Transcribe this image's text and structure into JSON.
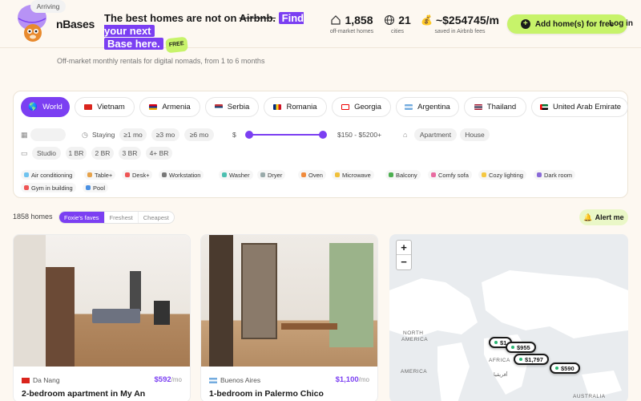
{
  "header": {
    "brand": "nBases",
    "promo": {
      "part1": "The best homes are not on ",
      "strike": "Airbnb.",
      "hl1": "Find your next",
      "hl2": "Base here.",
      "free": "FREE"
    },
    "stats": [
      {
        "icon": "house-icon",
        "value": "1,858",
        "label": "off-market homes"
      },
      {
        "icon": "globe-icon",
        "value": "21",
        "label": "cities"
      },
      {
        "icon": "money-bag-icon",
        "value": "~$254745/m",
        "label": "saved in Airbnb fees"
      }
    ],
    "add_button": "Add home(s) for free",
    "login": "Log in"
  },
  "tagline": "Off-market monthly rentals for digital nomads, from 1 to 6 months",
  "countries": [
    {
      "label": "World",
      "active": true
    },
    {
      "label": "Vietnam"
    },
    {
      "label": "Armenia"
    },
    {
      "label": "Serbia"
    },
    {
      "label": "Romania"
    },
    {
      "label": "Georgia"
    },
    {
      "label": "Argentina"
    },
    {
      "label": "Thailand"
    },
    {
      "label": "United Arab Emirate"
    }
  ],
  "filters": {
    "arriving": "Arriving",
    "staying": "Staying",
    "stay_options": [
      "≥1 mo",
      "≥3 mo",
      "≥6 mo"
    ],
    "currency_icon": "$",
    "price_range": "$150 - $5200+",
    "types": [
      "Apartment",
      "House"
    ],
    "bedrooms": [
      "Studio",
      "1 BR",
      "2 BR",
      "3 BR",
      "4+ BR"
    ]
  },
  "amenities": [
    "Air conditioning",
    "Table+",
    "Desk+",
    "Workstation",
    "Washer",
    "Dryer",
    "Oven",
    "Microwave",
    "Balcony",
    "Comfy sofa",
    "Cozy lighting",
    "Dark room",
    "Gym in building",
    "Pool"
  ],
  "results": {
    "count": "1858 homes",
    "sort": [
      "Foxie's faves",
      "Freshest",
      "Cheapest"
    ],
    "alert": "Alert me"
  },
  "listings": [
    {
      "city": "Da Nang",
      "price": "$592",
      "unit": "/mo",
      "title": "2-bedroom apartment in My An"
    },
    {
      "city": "Buenos Aires",
      "price": "$1,100",
      "unit": "/mo",
      "title": "1-bedroom in Palermo Chico"
    }
  ],
  "map": {
    "zoom_in": "+",
    "zoom_out": "−",
    "labels": [
      "NORTH",
      "AMERICA",
      "AFRICA",
      "أفريقيا",
      "AUSTRALIA",
      "AMERICA"
    ],
    "pins": [
      "$1",
      "$955",
      "$1,797",
      "$590"
    ]
  },
  "colors": {
    "accent": "#7b3ff2",
    "lime": "#c7f36a",
    "bg": "#fdf8f1"
  }
}
